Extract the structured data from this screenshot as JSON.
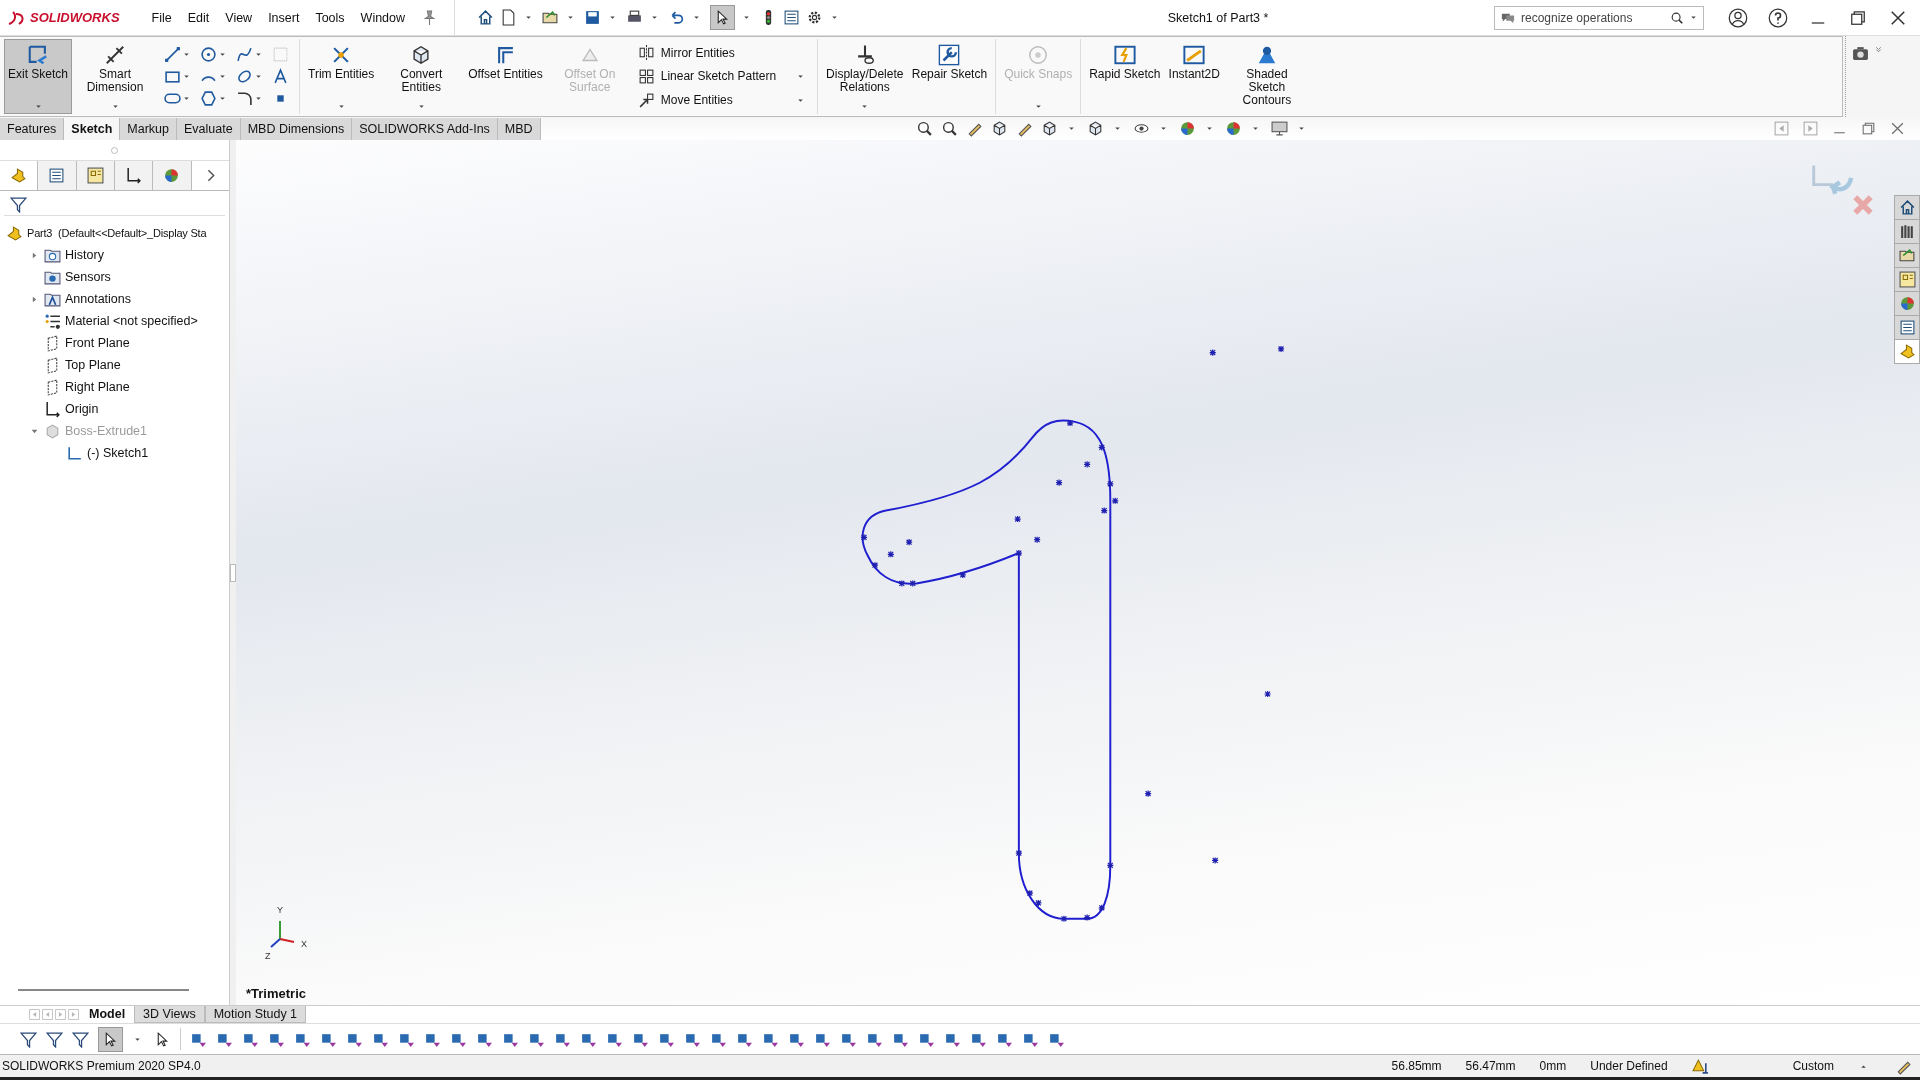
{
  "app": {
    "logo": "SOLIDWORKS"
  },
  "menu": [
    "File",
    "Edit",
    "View",
    "Insert",
    "Tools",
    "Window"
  ],
  "window": {
    "title": "Sketch1 of Part3 *"
  },
  "search": {
    "placeholder": "recognize operations"
  },
  "ribbon": {
    "left": [
      {
        "label": "Exit Sketch",
        "selected": true,
        "disabled": false,
        "dropdown": true
      },
      {
        "label": "Smart Dimension",
        "selected": false,
        "disabled": false,
        "dropdown": true
      }
    ],
    "middle": [
      {
        "label": "Trim Entities",
        "selected": false,
        "disabled": false,
        "dropdown": true
      },
      {
        "label": "Convert Entities",
        "selected": false,
        "disabled": false,
        "dropdown": true
      },
      {
        "label": "Offset Entities",
        "selected": false,
        "disabled": false,
        "dropdown": false
      },
      {
        "label": "Offset On Surface",
        "selected": false,
        "disabled": true,
        "dropdown": false
      }
    ],
    "small": [
      {
        "label": "Mirror Entities",
        "dropdown": false
      },
      {
        "label": "Linear Sketch Pattern",
        "dropdown": true
      },
      {
        "label": "Move Entities",
        "dropdown": true
      }
    ],
    "right": [
      {
        "label": "Display/Delete Relations",
        "selected": false,
        "disabled": false,
        "dropdown": true
      },
      {
        "label": "Repair Sketch",
        "selected": false,
        "disabled": false,
        "dropdown": false
      },
      {
        "label": "Quick Snaps",
        "selected": false,
        "disabled": true,
        "dropdown": true
      },
      {
        "label": "Rapid Sketch",
        "selected": false,
        "disabled": false,
        "dropdown": false
      },
      {
        "label": "Instant2D",
        "selected": false,
        "disabled": false,
        "dropdown": false
      },
      {
        "label": "Shaded Sketch Contours",
        "selected": false,
        "disabled": false,
        "dropdown": false
      }
    ]
  },
  "tabs": [
    {
      "label": "Features",
      "selected": false
    },
    {
      "label": "Sketch",
      "selected": true
    },
    {
      "label": "Markup",
      "selected": false
    },
    {
      "label": "Evaluate",
      "selected": false
    },
    {
      "label": "MBD Dimensions",
      "selected": false
    },
    {
      "label": "SOLIDWORKS Add-Ins",
      "selected": false
    },
    {
      "label": "MBD",
      "selected": false
    }
  ],
  "tree": {
    "label": "Part3  (Default<<Default>_Display Sta",
    "kind": "part",
    "children": [
      {
        "label": "History",
        "kind": "history",
        "expanded": false,
        "disabled": false
      },
      {
        "label": "Sensors",
        "kind": "sensors",
        "disabled": false
      },
      {
        "label": "Annotations",
        "kind": "annotations",
        "expanded": false,
        "disabled": false
      },
      {
        "label": "Material <not specified>",
        "kind": "material",
        "disabled": false
      },
      {
        "label": "Front Plane",
        "kind": "plane",
        "disabled": false
      },
      {
        "label": "Top Plane",
        "kind": "plane",
        "disabled": false
      },
      {
        "label": "Right Plane",
        "kind": "plane",
        "disabled": false
      },
      {
        "label": "Origin",
        "kind": "origin",
        "disabled": false
      },
      {
        "label": "Boss-Extrude1",
        "kind": "feature",
        "expanded": true,
        "disabled": true,
        "children": [
          {
            "label": "(-) Sketch1",
            "kind": "sketch",
            "disabled": false
          }
        ]
      }
    ]
  },
  "viewport": {
    "view_name": "*Trimetric",
    "triad": {
      "x": "X",
      "y": "Y",
      "z": "Z"
    }
  },
  "bottom_tabs": [
    {
      "label": "Model",
      "selected": true
    },
    {
      "label": "3D Views",
      "selected": false
    },
    {
      "label": "Motion Study 1",
      "selected": false
    }
  ],
  "status_bar": {
    "product": "SOLIDWORKS Premium 2020 SP4.0",
    "x": "56.85mm",
    "y": "56.47mm",
    "z": "0mm",
    "state": "Under Defined",
    "units": "Custom"
  }
}
